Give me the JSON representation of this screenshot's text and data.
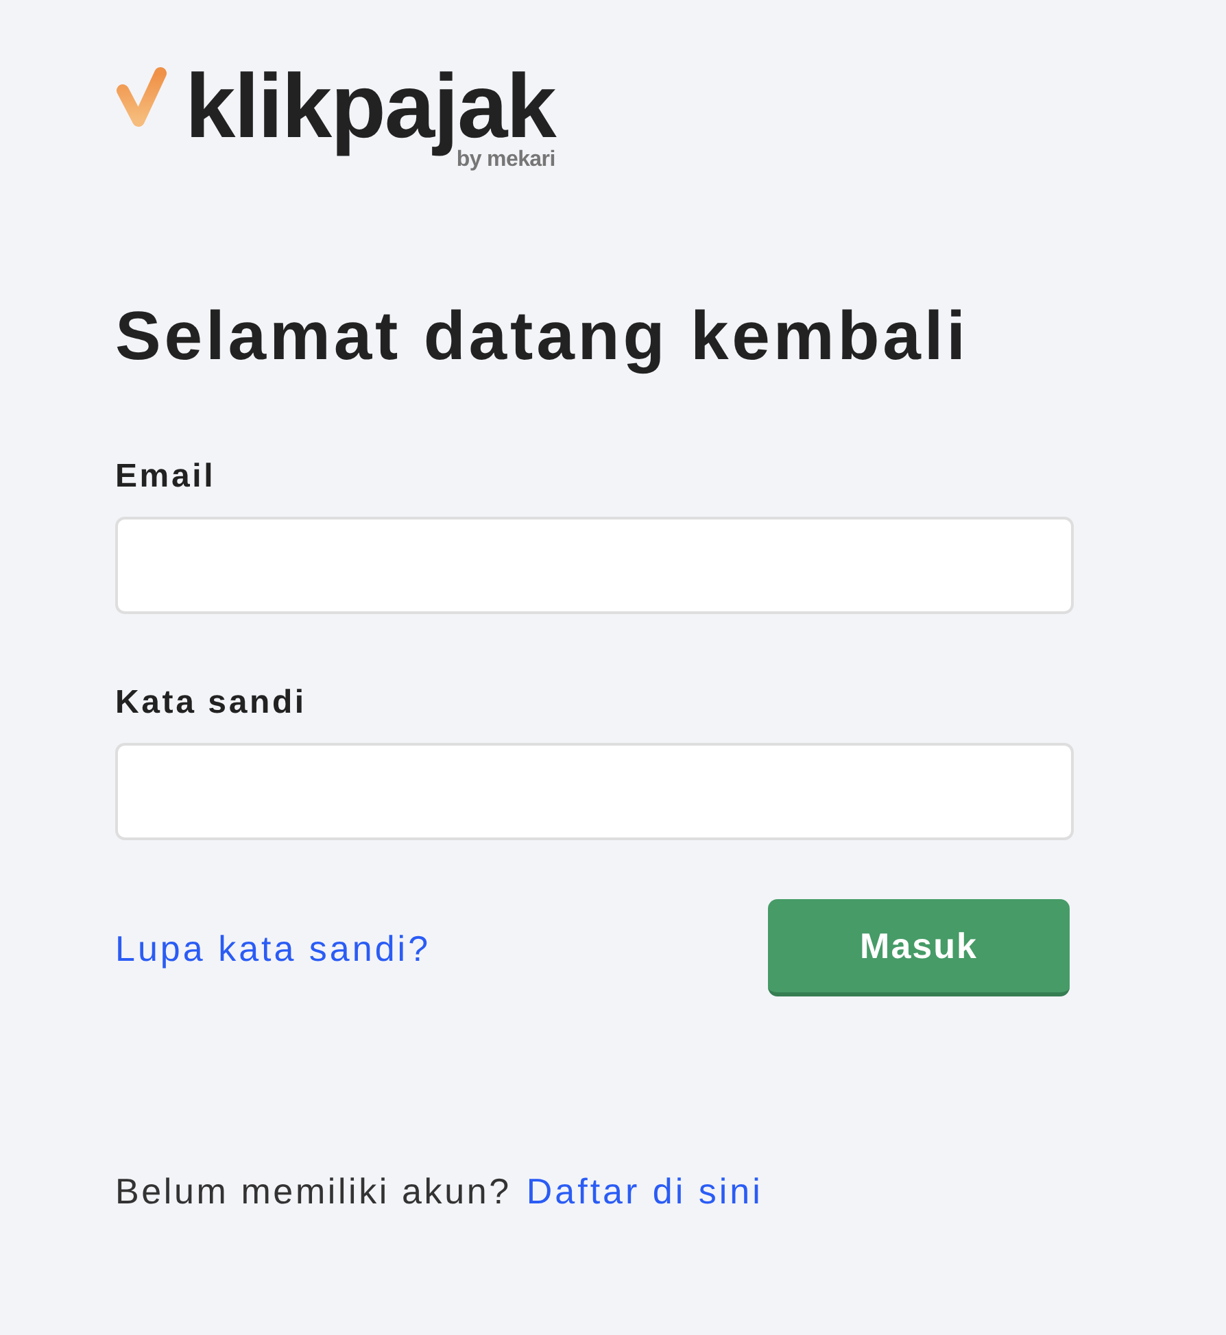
{
  "logo": {
    "wordmark": "klikpajak",
    "byline": "by mekari"
  },
  "heading": "Selamat datang kembali",
  "form": {
    "fields": [
      {
        "label": "Email"
      },
      {
        "label": "Kata sandi"
      }
    ],
    "forgot_link": "Lupa kata sandi?",
    "submit_button": "Masuk"
  },
  "signup": {
    "text": "Belum memiliki akun?",
    "link": "Daftar di sini"
  }
}
